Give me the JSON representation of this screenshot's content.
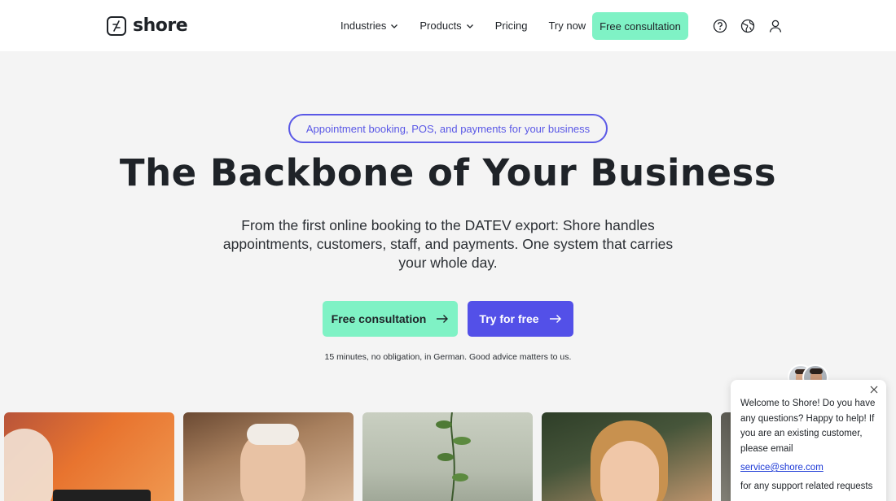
{
  "header": {
    "logo_text": "shore",
    "nav": [
      {
        "label": "Industries",
        "has_dropdown": true
      },
      {
        "label": "Products",
        "has_dropdown": true
      },
      {
        "label": "Pricing",
        "has_dropdown": false
      },
      {
        "label": "Try now",
        "has_dropdown": false
      }
    ],
    "cta_label": "Free consultation",
    "icons": [
      "help-icon",
      "language-globe-icon",
      "account-user-icon"
    ]
  },
  "hero": {
    "pill": "Appointment booking, POS, and payments for your business",
    "title": "The Backbone of Your Business",
    "subtitle": "From the first online booking to the DATEV export: Shore handles appointments, customers, staff, and payments. One system that carries your whole day.",
    "primary_button": "Free consultation",
    "secondary_button": "Try for free",
    "note": "15 minutes, no obligation, in German. Good advice matters to us."
  },
  "chat": {
    "message": "Welcome to Shore! Do you have any questions? Happy to help! If you are an existing customer, please email",
    "email": "service@shore.com",
    "tail": "for any support related requests"
  },
  "colors": {
    "accent_mint": "#7ff2c5",
    "accent_indigo": "#5350e8",
    "pill_border": "#5a58e6",
    "link": "#1a37d6"
  }
}
